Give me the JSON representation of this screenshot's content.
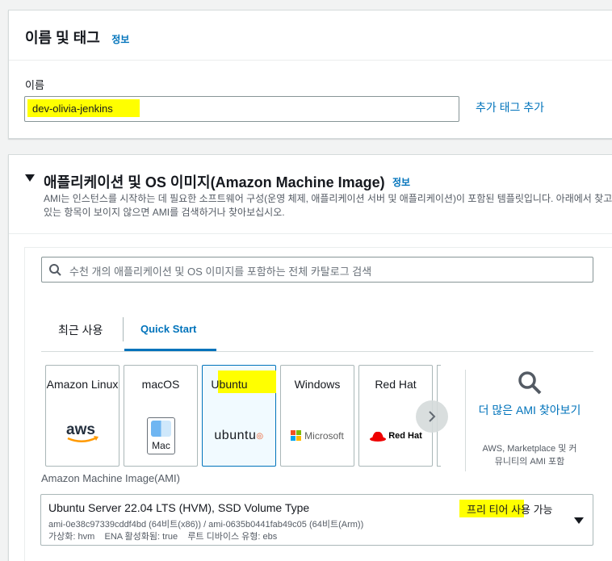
{
  "name_section": {
    "title": "이름 및 태그",
    "info": "정보",
    "name_label": "이름",
    "name_value": "dev-olivia-jenkins",
    "add_tag": "추가 태그 추가"
  },
  "ami_section": {
    "title": "애플리케이션 및 OS 이미지(Amazon Machine Image)",
    "info": "정보",
    "description": "AMI는 인스턴스를 시작하는 데 필요한 소프트웨어 구성(운영 체제, 애플리케이션 서버 및 애플리케이션)이 포함된 템플릿입니다. 아래에서 찾고 있는 항목이 보이지 않으면 AMI를 검색하거나 찾아보십시오.",
    "search_placeholder": "수천 개의 애플리케이션 및 OS 이미지를 포함하는 전체 카탈로그 검색",
    "tabs": [
      "최근 사용",
      "Quick Start"
    ],
    "tiles": [
      {
        "name": "Amazon Linux",
        "logo": "aws"
      },
      {
        "name": "macOS",
        "logo": "Mac"
      },
      {
        "name": "Ubuntu",
        "logo": "ubuntu"
      },
      {
        "name": "Windows",
        "logo": "Microsoft"
      },
      {
        "name": "Red Hat",
        "logo": "Red Hat"
      }
    ],
    "more_ami": "더 많은 AMI 찾아보기",
    "more_ami_sub": "AWS, Marketplace 및 커뮤니티의 AMI 포함",
    "ami_label": "Amazon Machine Image(AMI)",
    "selected": {
      "title": "Ubuntu Server 22.04 LTS (HVM), SSD Volume Type",
      "free_tier_highlight": "프리 티어",
      "free_tier_rest": " 사용 가능",
      "ids": "ami-0e38c97339cddf4bd (64비트(x86)) / ami-0635b0441fab49c05 (64비트(Arm))",
      "meta": "가상화: hvm    ENA 활성화됨: true    루트 디바이스 유형: ebs"
    }
  },
  "colors": {
    "link": "#0073bb",
    "highlight": "#ffff00",
    "selected_border": "#0073bb"
  }
}
